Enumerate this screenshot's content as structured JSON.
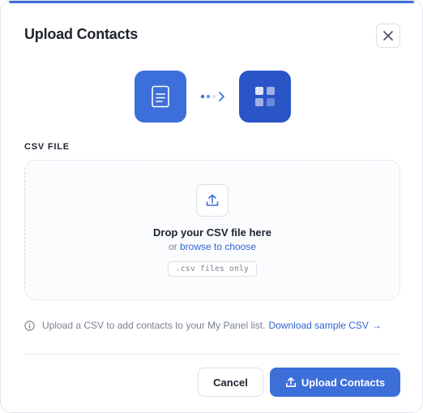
{
  "modal": {
    "title": "Upload Contacts",
    "close_icon": "close-icon",
    "accent_color": "#3c6fd8"
  },
  "illustration": {
    "source_icon": "document-icon",
    "flow_icon": "chevron-right-icon",
    "target_icon": "grid-icon"
  },
  "upload": {
    "section_label": "CSV FILE",
    "icon": "upload-icon",
    "drop_title": "Drop your CSV file here",
    "drop_prefix": "or",
    "browse_link": "browse to choose",
    "file_hint": ".csv files only"
  },
  "info": {
    "icon": "info-icon",
    "text": "Upload a CSV to add contacts to your My Panel list.",
    "download_link": "Download sample CSV",
    "arrow": "→"
  },
  "footer": {
    "cancel_label": "Cancel",
    "upload_label": "Upload Contacts",
    "upload_icon": "upload-icon"
  }
}
